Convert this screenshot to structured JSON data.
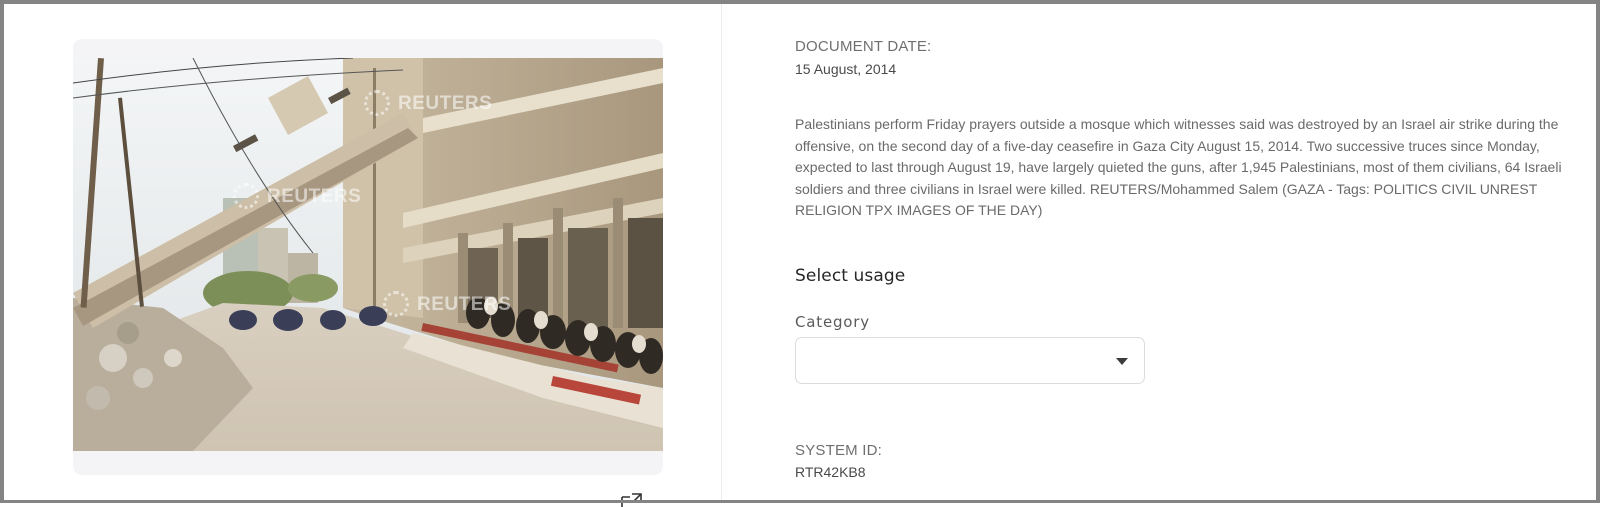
{
  "image_panel": {
    "watermark_text": "REUTERS",
    "share_icon": "external-link-icon"
  },
  "details": {
    "document_date_label": "DOCUMENT DATE:",
    "document_date_value": "15 August, 2014",
    "description": "Palestinians perform Friday prayers outside a mosque which witnesses said was destroyed by an Israel air strike during the offensive, on the second day of a five-day ceasefire in Gaza City August 15, 2014. Two successive truces since Monday, expected to last through August 19, have largely quieted the guns, after 1,945 Palestinians, most of them civilians, 64 Israeli soldiers and three civilians in Israel were killed. REUTERS/Mohammed Salem (GAZA - Tags: POLITICS CIVIL UNREST RELIGION TPX IMAGES OF THE DAY)",
    "select_usage_heading": "Select usage",
    "category_label": "Category",
    "category_value": "",
    "system_id_label": "SYSTEM ID:",
    "system_id_value": "RTR42KB8"
  },
  "colors": {
    "frame": "#848484",
    "card_background": "#f4f4f7",
    "text_muted": "#6a6a6a",
    "heading": "#262626"
  }
}
